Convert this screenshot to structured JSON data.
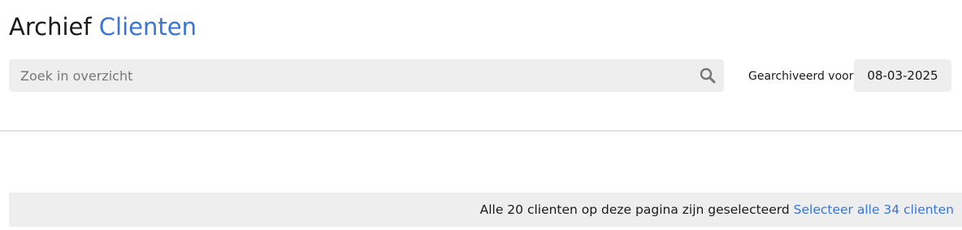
{
  "header": {
    "title_main": "Archief",
    "title_accent": "Clienten"
  },
  "search": {
    "placeholder": "Zoek in overzicht",
    "value": "",
    "icon": "search-icon"
  },
  "filter": {
    "archived_label": "Gearchiveerd voor",
    "archived_date": "08-03-2025"
  },
  "selection": {
    "message": "Alle 20 clienten op deze pagina zijn geselecteerd",
    "select_all_link": "Selecteer alle 34 clienten"
  },
  "colors": {
    "accent": "#3a75d6",
    "field_bg": "#eeeeee",
    "divider": "#e4e4e4"
  }
}
